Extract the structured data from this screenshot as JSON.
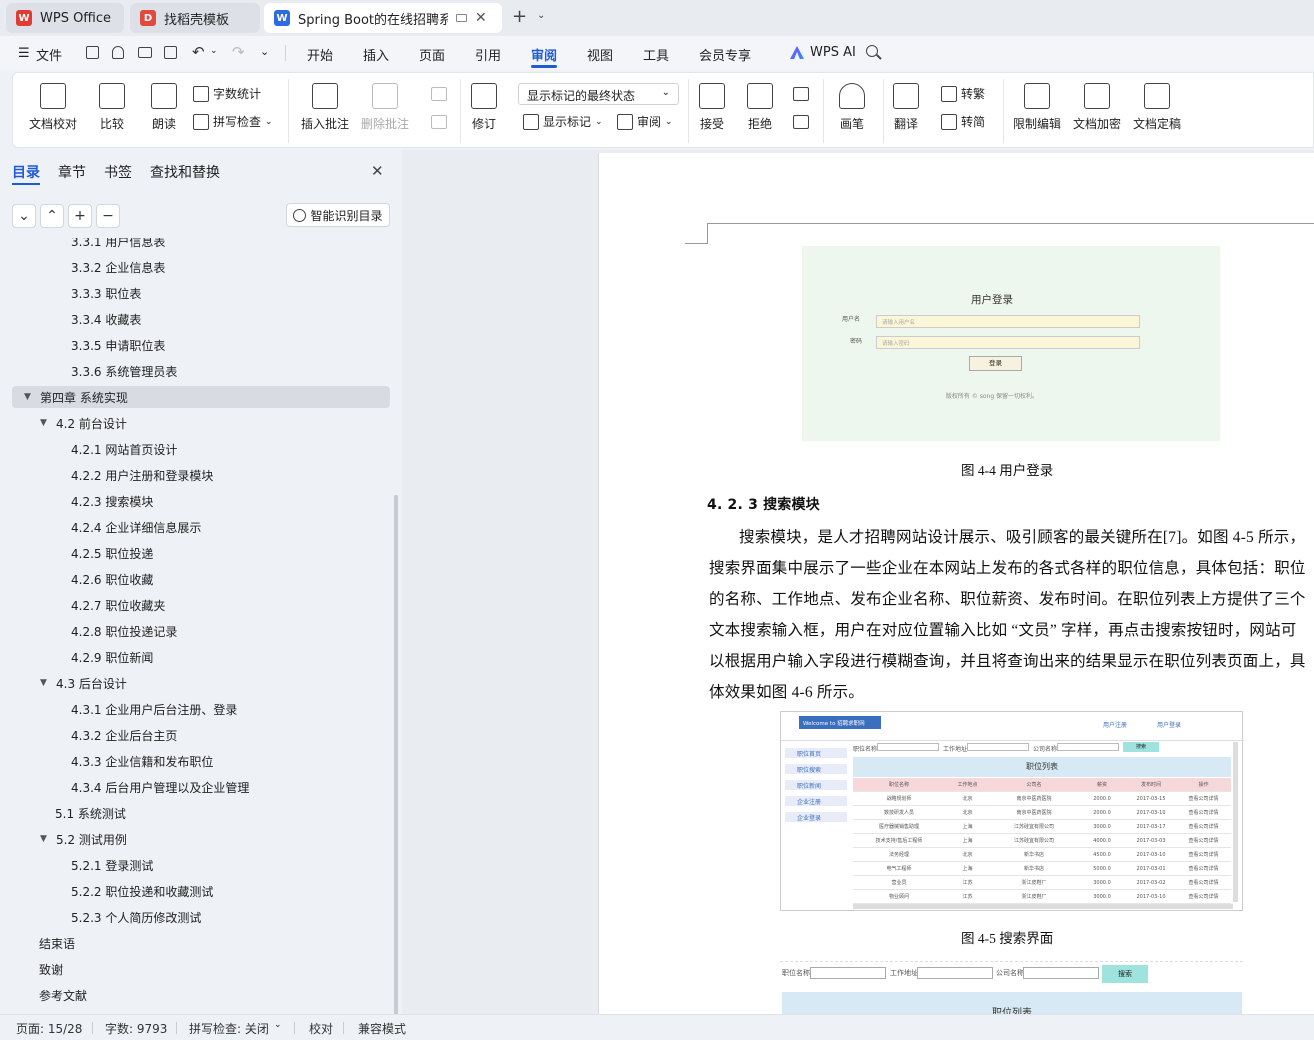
{
  "tabs": [
    {
      "label": "WPS Office"
    },
    {
      "label": "找稻壳模板"
    },
    {
      "label": "Spring Boot的在线招聘系统设"
    }
  ],
  "menu": {
    "file": "文件",
    "items": [
      "开始",
      "插入",
      "页面",
      "引用",
      "审阅",
      "视图",
      "工具",
      "会员专享"
    ],
    "active": "审阅",
    "wps_ai": "WPS AI"
  },
  "ribbon": {
    "doc_check": "文档校对",
    "compare": "比较",
    "read_aloud": "朗读",
    "word_count": "字数统计",
    "spell_check": "拼写检查",
    "insert_comment": "插入批注",
    "delete_comment": "删除批注",
    "revise": "修订",
    "markup_state": "显示标记的最终状态",
    "show_markup": "显示标记",
    "review": "审阅",
    "accept": "接受",
    "reject": "拒绝",
    "brush": "画笔",
    "translate": "翻译",
    "to_traditional": "转繁",
    "to_simplified": "转简",
    "restrict_edit": "限制编辑",
    "encrypt": "文档加密",
    "finalize": "文档定稿"
  },
  "nav": {
    "tabs": [
      "目录",
      "章节",
      "书签",
      "查找和替换"
    ],
    "smart_toc": "智能识别目录",
    "items": [
      {
        "text": "3.3.1  用户信息表",
        "level": 3
      },
      {
        "text": "3.3.2  企业信息表",
        "level": 3
      },
      {
        "text": "3.3.3  职位表",
        "level": 3
      },
      {
        "text": "3.3.4  收藏表",
        "level": 3
      },
      {
        "text": "3.3.5  申请职位表",
        "level": 3
      },
      {
        "text": "3.3.6  系统管理员表",
        "level": 3
      },
      {
        "text": "第四章  系统实现",
        "level": 1,
        "expanded": true,
        "selected": true
      },
      {
        "text": "4.2  前台设计",
        "level": 2,
        "expanded": true
      },
      {
        "text": "4.2.1  网站首页设计",
        "level": 3
      },
      {
        "text": "4.2.2  用户注册和登录模块",
        "level": 3
      },
      {
        "text": "4.2.3  搜索模块",
        "level": 3
      },
      {
        "text": "4.2.4  企业详细信息展示",
        "level": 3
      },
      {
        "text": "4.2.5  职位投递",
        "level": 3
      },
      {
        "text": "4.2.6  职位收藏",
        "level": 3
      },
      {
        "text": "4.2.7  职位收藏夹",
        "level": 3
      },
      {
        "text": "4.2.8  职位投递记录",
        "level": 3
      },
      {
        "text": "4.2.9  职位新闻",
        "level": 3
      },
      {
        "text": "4.3  后台设计",
        "level": 2,
        "expanded": true
      },
      {
        "text": "4.3.1  企业用户后台注册、登录",
        "level": 3
      },
      {
        "text": "4.3.2  企业后台主页",
        "level": 3
      },
      {
        "text": "4.3.3  企业信籍和发布职位",
        "level": 3
      },
      {
        "text": "4.3.4  后台用户管理以及企业管理",
        "level": 3
      },
      {
        "text": "5.1  系统测试",
        "level": 2
      },
      {
        "text": "5.2 测试用例",
        "level": 2,
        "expanded": true
      },
      {
        "text": "5.2.1  登录测试",
        "level": 3
      },
      {
        "text": "5.2.2  职位投递和收藏测试",
        "level": 3
      },
      {
        "text": "5.2.3  个人简历修改测试",
        "level": 3
      },
      {
        "text": "结束语",
        "level": 1
      },
      {
        "text": "致谢",
        "level": 1
      },
      {
        "text": "参考文献",
        "level": 1
      }
    ]
  },
  "doc": {
    "login_fig": {
      "title": "用户登录",
      "user_label": "用户名",
      "user_ph": "请输入用户名",
      "pwd_label": "密码",
      "pwd_ph": "请输入密码",
      "btn": "登录",
      "footer": "版权所有 © song 保留一切权利。"
    },
    "cap_44": "图 4-4  用户登录",
    "heading": "4. 2. 3  搜索模块",
    "lines": [
      "搜索模块，是人才招聘网站设计展示、吸引顾客的最关键所在[7]。如图 4-5 所示，",
      "搜索界面集中展示了一些企业在本网站上发布的各式各样的职位信息，具体包括：职位",
      "的名称、工作地点、发布企业名称、职位薪资、发布时间。在职位列表上方提供了三个",
      "文本搜索输入框，用户在对应位置输入比如 “文员” 字样，再点击搜索按钮时，网站可",
      "以根据用户输入字段进行模糊查询，并且将查询出来的结果显示在职位列表页面上，具",
      "体效果如图 4-6 所示。"
    ],
    "search_fig": {
      "welcome": "Welcome to 招聘求职网",
      "reg": "用户注册",
      "login": "用户登录",
      "side": [
        "职位首页",
        "职位搜索",
        "职位新闻",
        "企业注册",
        "企业登录"
      ],
      "f1": "职位名称",
      "f2": "工作地址",
      "f3": "公司名称",
      "search": "搜索",
      "list_title": "职位列表",
      "cols": [
        "职位名称",
        "工作地点",
        "公司名",
        "薪资",
        "发布时间",
        "操作"
      ],
      "rows": [
        [
          "战略规划师",
          "北京",
          "南京中医药医院",
          "2000.0",
          "2017-03-15",
          "查看公司详情"
        ],
        [
          "数技研发人员",
          "北京",
          "南京中医药医院",
          "2000.0",
          "2017-03-10",
          "查看公司详情"
        ],
        [
          "医疗器械销售助理",
          "上海",
          "江苏硅宜有限公司",
          "3000.0",
          "2017-03-17",
          "查看公司详情"
        ],
        [
          "技术支持/售后工程师",
          "上海",
          "江苏硅宜有限公司",
          "4000.0",
          "2017-03-03",
          "查看公司详情"
        ],
        [
          "法务经理",
          "北京",
          "新华书店",
          "4500.0",
          "2017-03-10",
          "查看公司详情"
        ],
        [
          "电气工程师",
          "上海",
          "新华书店",
          "5000.0",
          "2017-03-01",
          "查看公司详情"
        ],
        [
          "营业员",
          "江苏",
          "浙江皮鞋厂",
          "3000.0",
          "2017-03-02",
          "查看公司详情"
        ],
        [
          "物业顾问",
          "江苏",
          "浙江皮鞋厂",
          "3000.0",
          "2017-03-10",
          "查看公司详情"
        ]
      ]
    },
    "cap_45": "图 4-5  搜索界面",
    "fig46": {
      "f1": "职位名称",
      "f2": "工作地址",
      "f3": "公司名称",
      "search": "搜索",
      "list_title": "职位列表"
    }
  },
  "status": {
    "page": "页面: 15/28",
    "words": "字数: 9793",
    "spell": "拼写检查: 关闭",
    "proof": "校对",
    "compat": "兼容模式"
  }
}
